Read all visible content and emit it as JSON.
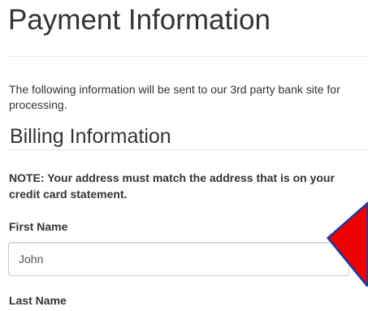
{
  "page": {
    "title": "Payment Information",
    "intro": "The following information will be sent to our 3rd party bank site for processing."
  },
  "billing": {
    "title": "Billing Information",
    "note": "NOTE: Your address must match the address that is on your credit card statement.",
    "first_name_label": "First Name",
    "first_name_value": "John",
    "last_name_label": "Last Name"
  },
  "annotation": {
    "icon": "red-arrow-icon",
    "color": "#ee0000",
    "outline_color": "#2a3a8c"
  }
}
